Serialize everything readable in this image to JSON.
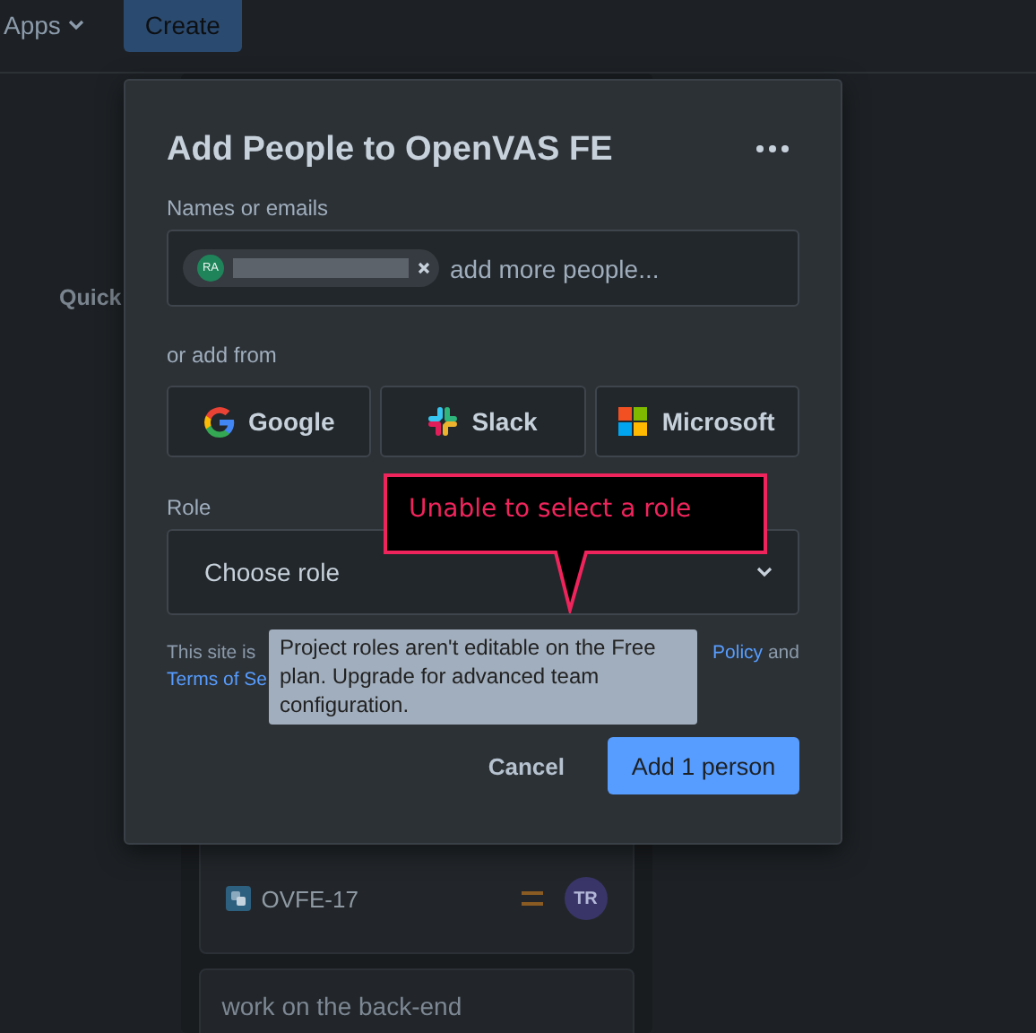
{
  "topbar": {
    "apps_menu": "Apps",
    "create_button": "Create"
  },
  "background": {
    "quick_heading": "Quick",
    "card": {
      "issue_key": "OVFE-17",
      "assignee": "TR"
    },
    "next_card": {
      "title": "work on the back-end"
    }
  },
  "dialog": {
    "title": "Add People to OpenVAS FE",
    "names_label": "Names or emails",
    "chips": [
      {
        "initials": "RA"
      }
    ],
    "placeholder": "add more people...",
    "add_from_label": "or add from",
    "providers": [
      {
        "kind": "google",
        "label": "Google"
      },
      {
        "kind": "slack",
        "label": "Slack"
      },
      {
        "kind": "microsoft",
        "label": "Microsoft"
      }
    ],
    "role_label": "Role",
    "role_placeholder": "Choose role",
    "notice": {
      "start": "This site is",
      "link": "Policy",
      "after_link": "and",
      "second_link": "Terms of Se"
    },
    "cancel_button": "Cancel",
    "submit_button": "Add 1 person"
  },
  "tooltip": "Project roles aren't editable on the Free plan. Upgrade for advanced team configuration.",
  "callout": "Unable to select a role"
}
